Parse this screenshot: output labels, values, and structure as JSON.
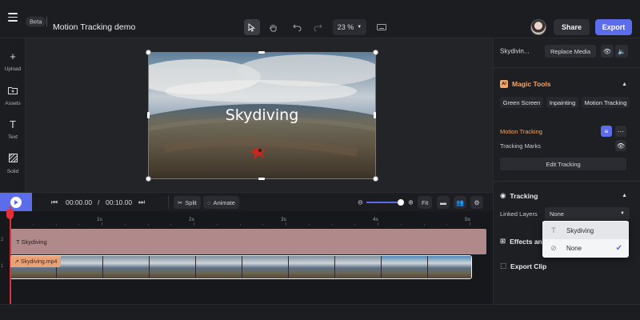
{
  "header": {
    "beta": "Beta",
    "title": "Motion Tracking demo",
    "zoom": "23 %",
    "share": "Share",
    "export": "Export"
  },
  "sidebar": {
    "items": [
      {
        "label": "Upload",
        "icon": "plus-icon"
      },
      {
        "label": "Assets",
        "icon": "folder-icon"
      },
      {
        "label": "Text",
        "icon": "text-icon"
      },
      {
        "label": "Solid",
        "icon": "solid-icon"
      }
    ]
  },
  "canvas": {
    "overlay_text": "Skydiving"
  },
  "playback": {
    "current": "00:00.00",
    "sep": "/",
    "total": "00:10.00",
    "split": "Split",
    "animate": "Animate",
    "fit": "Fit"
  },
  "timeline": {
    "ticks": [
      "1s",
      "2s",
      "3s",
      "4s",
      "5s"
    ],
    "track_numbers": [
      "2",
      "1"
    ],
    "text_track": "Skydiving",
    "video_track": "Skydiving.mp4"
  },
  "panel": {
    "asset_name": "Skydivin...",
    "replace": "Replace Media",
    "magic_title": "Magic Tools",
    "ai_badge": "AI",
    "chips": [
      "Green Screen",
      "Inpainting",
      "Motion Tracking"
    ],
    "motion_tracking": "Motion Tracking",
    "tracking_marks": "Tracking Marks",
    "edit_tracking": "Edit Tracking",
    "tracking_title": "Tracking",
    "linked_layers": "Linked Layers",
    "linked_value": "None",
    "effects": "Effects and",
    "export_clip": "Export Clip"
  },
  "dropdown": {
    "options": [
      {
        "label": "Skydiving",
        "icon": "text-icon"
      },
      {
        "label": "None",
        "icon": "none-icon",
        "selected": true
      }
    ]
  },
  "colors": {
    "accent": "#5b6dea",
    "magic": "#f3a46b",
    "text_track": "#b0898a",
    "video_tag": "#e9a176",
    "playhead": "#e0313a"
  }
}
